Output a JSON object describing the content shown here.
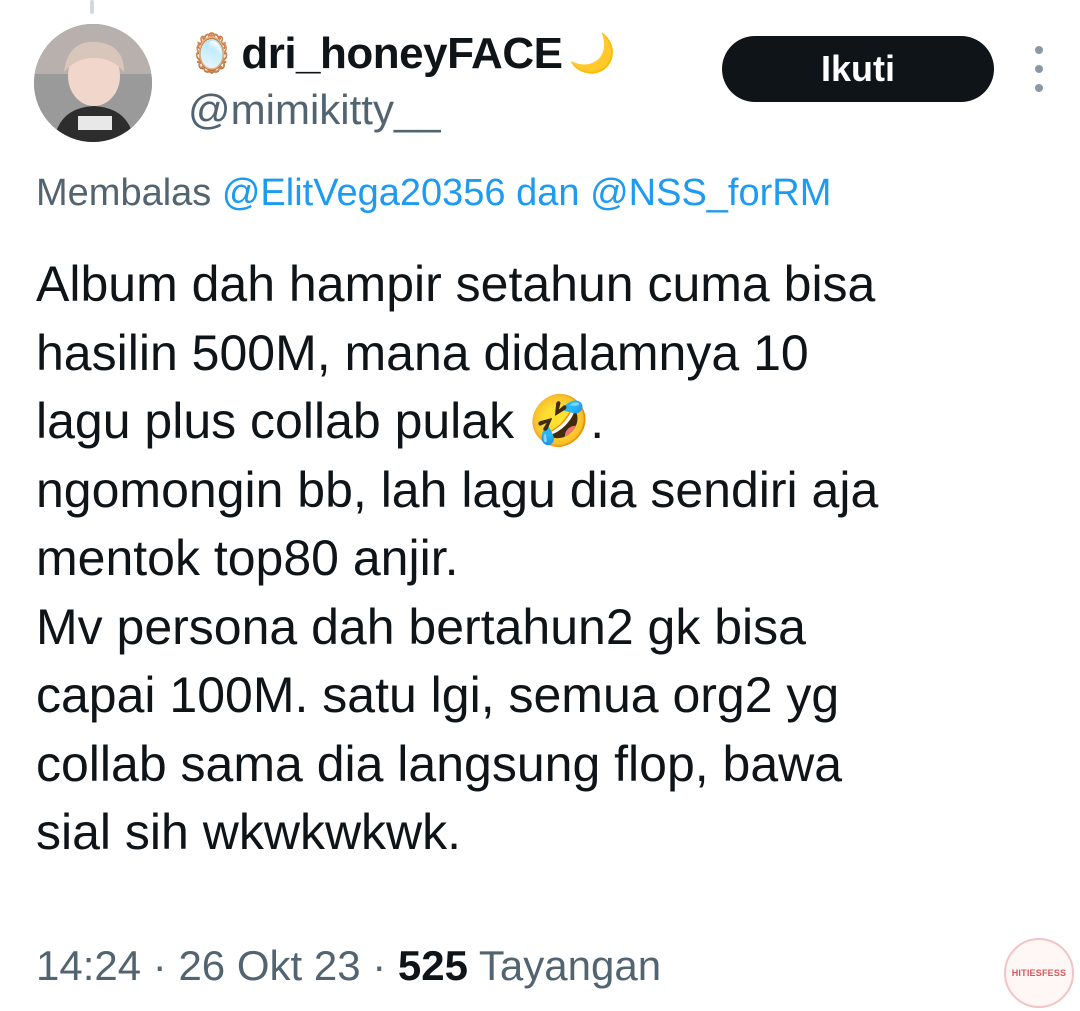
{
  "header": {
    "display_name": "dri_honeyFACE",
    "name_prefix_emoji": "🪞",
    "name_suffix_emoji": "🌙",
    "handle": "@mimikitty__",
    "follow_label": "Ikuti",
    "more_icon": "more-vertical-icon"
  },
  "reply": {
    "prefix": "Membalas",
    "mention_1": "@ElitVega20356",
    "conjunction": "dan",
    "mention_2": "@NSS_forRM"
  },
  "tweet": {
    "text": "Album dah hampir setahun cuma bisa\nhasilin 500M, mana didalamnya 10\nlagu plus collab pulak 🤣.\nngomongin bb, lah lagu dia sendiri aja\nmentok top80 anjir.\nMv persona dah bertahun2 gk bisa\ncapai 100M. satu lgi, semua org2 yg\ncollab sama dia langsung flop, bawa\nsial sih wkwkwkwk."
  },
  "meta": {
    "time": "14:24",
    "separator": "·",
    "date": "26 Okt 23",
    "views_count": "525",
    "views_label": "Tayangan"
  },
  "watermark": {
    "text": "HITIESFESS"
  },
  "colors": {
    "text_primary": "#0f1419",
    "text_secondary": "#536471",
    "link": "#1d9bf0",
    "button_bg": "#0f1419"
  }
}
